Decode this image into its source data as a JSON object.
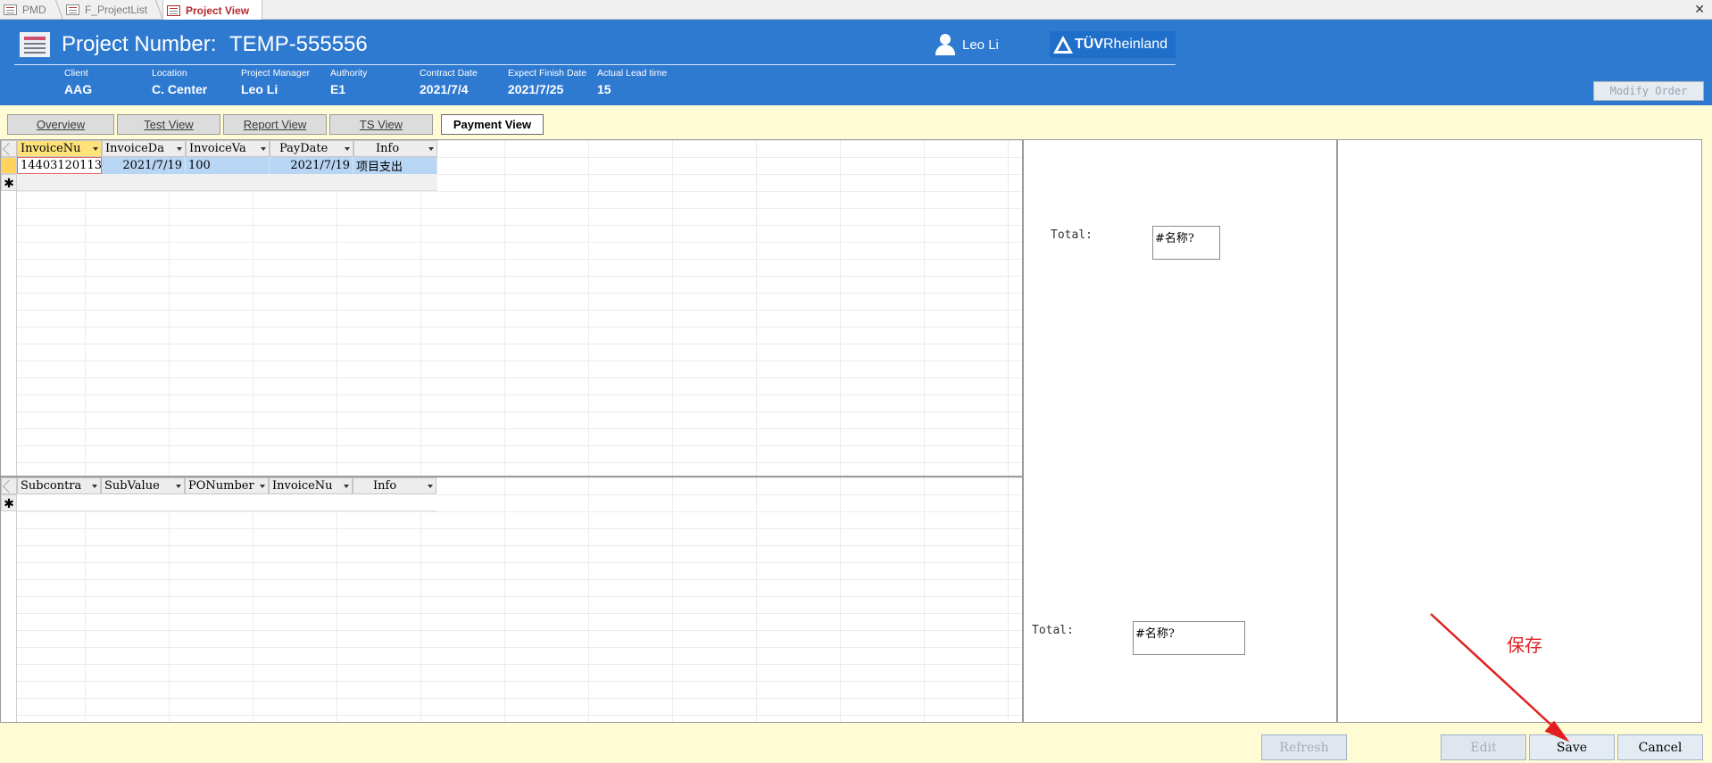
{
  "tabs": [
    {
      "label": "PMD"
    },
    {
      "label": "F_ProjectList"
    },
    {
      "label": "Project View"
    }
  ],
  "header": {
    "project_label": "Project Number:",
    "project_number": "TEMP-555556",
    "user_name": "Leo Li",
    "logo_text": "TÜV",
    "logo_text2": "Rheinland",
    "fields": [
      {
        "label": "Client",
        "value": "AAG"
      },
      {
        "label": "Location",
        "value": "C. Center"
      },
      {
        "label": "Project Manager",
        "value": "Leo Li"
      },
      {
        "label": "Authority",
        "value": "E1"
      },
      {
        "label": "Contract Date",
        "value": "2021/7/4"
      },
      {
        "label": "Expect Finish Date",
        "value": "2021/7/25"
      },
      {
        "label": "Actual Lead time",
        "value": "15"
      }
    ],
    "modify_label": "Modify Order"
  },
  "views": [
    {
      "label": "Overview"
    },
    {
      "label": "Test View"
    },
    {
      "label": "Report View"
    },
    {
      "label": "TS View"
    },
    {
      "label": "Payment View"
    }
  ],
  "invoice_grid": {
    "columns": [
      "InvoiceNu",
      "InvoiceDa",
      "InvoiceVa",
      "PayDate",
      "Info"
    ],
    "rows": [
      [
        "14403120113",
        "2021/7/19",
        "100",
        "2021/7/19",
        "项目支出"
      ]
    ],
    "new_marker": "✱"
  },
  "sub_grid": {
    "columns": [
      "Subcontra",
      "SubValue",
      "PONumber",
      "InvoiceNu",
      "Info"
    ],
    "new_marker": "✱"
  },
  "totals": [
    {
      "label": "Total:",
      "value": "#名称?"
    },
    {
      "label": "Total:",
      "value": "#名称?"
    }
  ],
  "buttons": {
    "refresh": "Refresh",
    "edit": "Edit",
    "save": "Save",
    "cancel": "Cancel"
  },
  "annotation": "保存",
  "colors": {
    "header_bg": "#2f7ad1",
    "form_bg": "#fffbd5",
    "active_tab": "#b4282d",
    "annotation": "#e02020"
  }
}
